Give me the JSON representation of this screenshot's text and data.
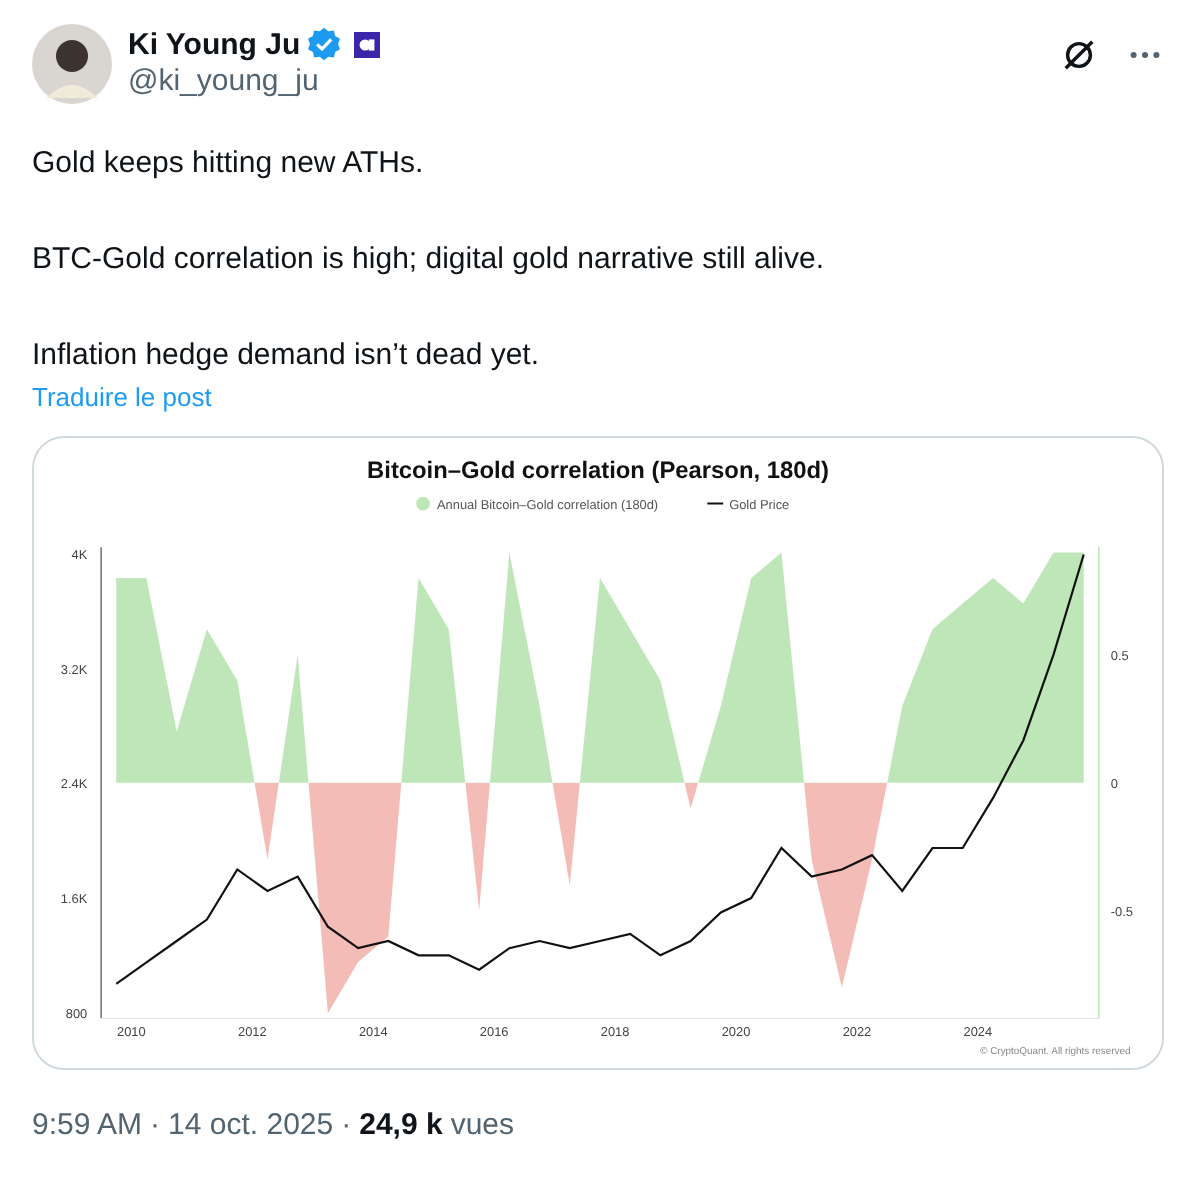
{
  "author": {
    "name": "Ki Young Ju",
    "handle": "@ki_young_ju",
    "verified": true
  },
  "paragraphs": [
    "Gold keeps hitting new ATHs.",
    "BTC-Gold correlation is high; digital gold narrative still alive.",
    "Inflation hedge demand isn’t dead yet."
  ],
  "translate_link": "Traduire le post",
  "chart": {
    "copyright": "© CryptoQuant. All rights reserved",
    "chart_data": {
      "type": "area",
      "title": "Bitcoin–Gold correlation (Pearson, 180d)",
      "x": [
        2009.75,
        2010.25,
        2010.75,
        2011.25,
        2011.75,
        2012.25,
        2012.75,
        2013.25,
        2013.75,
        2014.25,
        2014.75,
        2015.25,
        2015.75,
        2016.25,
        2016.75,
        2017.25,
        2017.75,
        2018.25,
        2018.75,
        2019.25,
        2019.75,
        2020.25,
        2020.75,
        2021.25,
        2021.75,
        2022.25,
        2022.75,
        2023.25,
        2023.75,
        2024.25,
        2024.75,
        2025.25,
        2025.75
      ],
      "series": [
        {
          "name": "Annual Bitcoin–Gold correlation (180d)",
          "color": "#bfe6b8",
          "type": "area",
          "axis": "y2",
          "values": [
            0.8,
            0.8,
            0.2,
            0.6,
            0.4,
            -0.3,
            0.5,
            -0.9,
            -0.7,
            -0.6,
            0.8,
            0.6,
            -0.5,
            0.9,
            0.3,
            -0.4,
            0.8,
            0.6,
            0.4,
            -0.1,
            0.3,
            0.8,
            0.9,
            -0.3,
            -0.8,
            -0.3,
            0.3,
            0.6,
            0.7,
            0.8,
            0.7,
            0.9,
            0.9
          ]
        },
        {
          "name": "Gold Price",
          "color": "#111111",
          "type": "line",
          "values": [
            1000,
            1150,
            1300,
            1450,
            1800,
            1650,
            1750,
            1400,
            1250,
            1300,
            1200,
            1200,
            1100,
            1250,
            1300,
            1250,
            1300,
            1350,
            1200,
            1300,
            1500,
            1600,
            1950,
            1750,
            1800,
            1900,
            1650,
            1950,
            1950,
            2300,
            2700,
            3300,
            4000
          ]
        }
      ],
      "legend": "top",
      "xlim": [
        2009.5,
        2026
      ],
      "ylim": [
        760,
        4050
      ],
      "y2lim": [
        -0.92,
        0.92
      ],
      "xticks": [
        2010,
        2012,
        2014,
        2016,
        2018,
        2020,
        2022,
        2024
      ],
      "yticks": [
        {
          "value": 4000,
          "label": "4K"
        },
        {
          "value": 3200,
          "label": "3.2K"
        },
        {
          "value": 2400,
          "label": "2.4K"
        },
        {
          "value": 1600,
          "label": "1.6K"
        },
        {
          "value": 800,
          "label": "800"
        }
      ],
      "y2ticks": [
        0.5,
        0,
        -0.5
      ]
    }
  },
  "footer": [
    {
      "kind": "link",
      "text": "9:59 AM"
    },
    {
      "kind": "separator",
      "text": "·"
    },
    {
      "kind": "link",
      "text": "14 oct. 2025"
    },
    {
      "kind": "separator",
      "text": "·"
    },
    {
      "kind": "count",
      "text": "24,9 k"
    },
    {
      "kind": "label",
      "text": "vues"
    }
  ]
}
